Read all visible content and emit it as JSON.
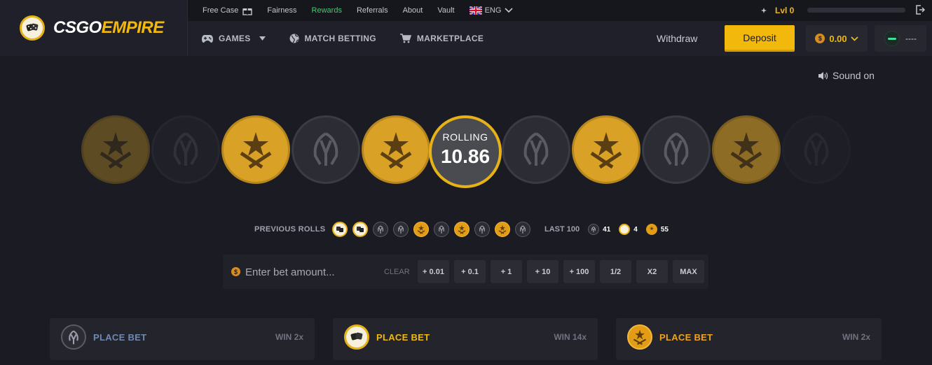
{
  "brand": {
    "name_part1": "CSGO",
    "name_part2": "EMPIRE"
  },
  "subnav": {
    "links": [
      {
        "label": "Free Case"
      },
      {
        "label": "Fairness"
      },
      {
        "label": "Rewards"
      },
      {
        "label": "Referrals"
      },
      {
        "label": "About"
      },
      {
        "label": "Vault"
      },
      {
        "label": "ENG"
      }
    ],
    "level": "Lvl 0",
    "level_progress": 0
  },
  "mainnav": {
    "games": "GAMES",
    "match_betting": "MATCH BETTING",
    "marketplace": "MARKETPLACE"
  },
  "account": {
    "withdraw": "Withdraw",
    "deposit": "Deposit",
    "balance": "0.00",
    "username": "----"
  },
  "sound": "Sound on",
  "roll": {
    "status": "ROLLING",
    "value": "10.86"
  },
  "reel": [
    "t",
    "ct",
    "t",
    "ct",
    "t",
    "center",
    "ct",
    "t",
    "ct",
    "t",
    "ct"
  ],
  "previous_rolls": {
    "label": "PREVIOUS ROLLS",
    "items": [
      "dice",
      "dice",
      "ct",
      "ct",
      "t",
      "ct",
      "t",
      "ct",
      "t",
      "ct"
    ]
  },
  "last100": {
    "label": "LAST 100",
    "ct": "41",
    "dice": "4",
    "t": "55"
  },
  "bet": {
    "placeholder": "Enter bet amount...",
    "clear": "CLEAR",
    "buttons": [
      "+ 0.01",
      "+ 0.1",
      "+ 1",
      "+ 10",
      "+ 100",
      "1/2",
      "X2",
      "MAX"
    ]
  },
  "panels": [
    {
      "label": "PLACE BET",
      "win": "WIN 2x",
      "color": "#6e8ab2",
      "type": "ct"
    },
    {
      "label": "PLACE BET",
      "win": "WIN 14x",
      "color": "#f2b90c",
      "type": "dice"
    },
    {
      "label": "PLACE BET",
      "win": "WIN 2x",
      "color": "#f2a31b",
      "type": "t"
    }
  ],
  "colors": {
    "accent": "#f2b90c",
    "background": "#1b1c23",
    "rewards_green": "#3ccf6a"
  }
}
